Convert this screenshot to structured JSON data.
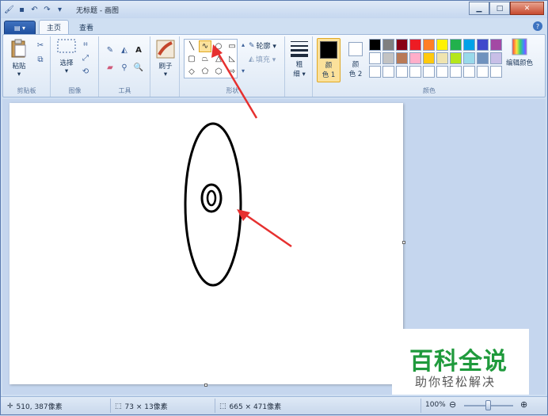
{
  "window": {
    "title": "无标题 - 画图",
    "quick_access": [
      "app-menu-icon",
      "save-icon",
      "undo-icon",
      "redo-icon",
      "dropdown-icon"
    ]
  },
  "tabs": {
    "file_label": "▤ ▾",
    "items": [
      {
        "label": "主页",
        "active": true
      },
      {
        "label": "查看",
        "active": false
      }
    ]
  },
  "ribbon": {
    "clipboard": {
      "group_label": "剪贴板",
      "paste_label": "粘贴",
      "paste_arrow": "▾"
    },
    "image": {
      "group_label": "图像",
      "select_label": "选择",
      "select_arrow": "▾"
    },
    "tools": {
      "group_label": "工具"
    },
    "brushes": {
      "label": "刷子",
      "arrow": "▾"
    },
    "shapes": {
      "group_label": "形状",
      "outline_label": "轮廓 ▾",
      "fill_label": "填充 ▾"
    },
    "size": {
      "label_line1": "粗",
      "label_line2": "细 ▾"
    },
    "colors": {
      "group_label": "颜色",
      "color1_line1": "颜",
      "color1_line2": "色 1",
      "color2_line1": "颜",
      "color2_line2": "色 2",
      "edit_label": "编辑颜色",
      "color1": "#000000",
      "color2": "#ffffff",
      "palette_row1": [
        "#000000",
        "#7f7f7f",
        "#880015",
        "#ed1c24",
        "#ff7f27",
        "#fff200",
        "#22b14c",
        "#00a2e8",
        "#3f48cc",
        "#a349a4"
      ],
      "palette_row2": [
        "#ffffff",
        "#c3c3c3",
        "#b97a57",
        "#ffaec9",
        "#ffc90e",
        "#efe4b0",
        "#b5e61d",
        "#99d9ea",
        "#7092be",
        "#c8bfe7"
      ],
      "palette_row3": [
        "#ffffff",
        "#ffffff",
        "#ffffff",
        "#ffffff",
        "#ffffff",
        "#ffffff",
        "#ffffff",
        "#ffffff",
        "#ffffff",
        "#ffffff"
      ]
    }
  },
  "status": {
    "cursor_pos": "510, 387像素",
    "selection_size": "73 × 13像素",
    "canvas_size": "665 × 471像素",
    "zoom": "100%",
    "zoom_minus": "⊖",
    "zoom_plus": "⊕"
  },
  "watermark": {
    "title": "百科全说",
    "subtitle": "助你轻松解决"
  }
}
